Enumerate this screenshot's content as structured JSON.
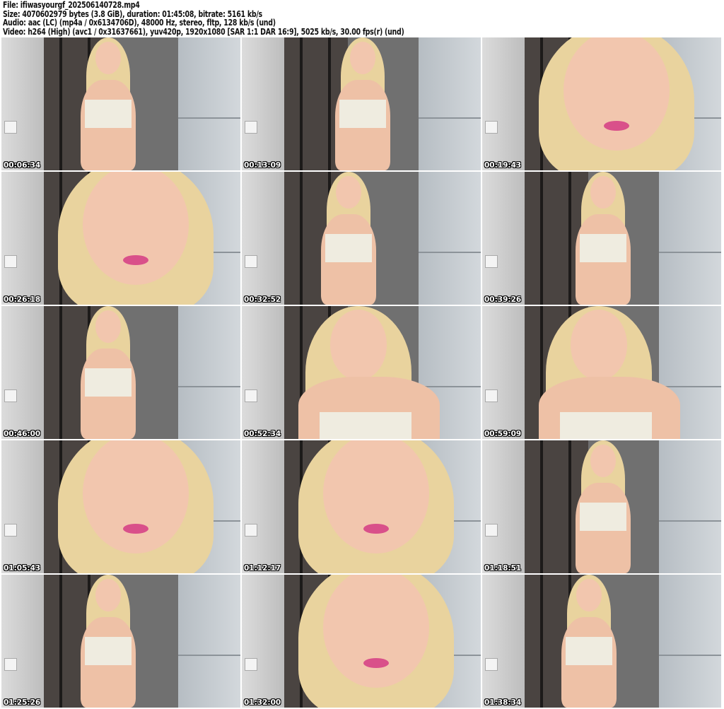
{
  "header": {
    "file_line": "File: ifiwasyourgf_202506140728.mp4",
    "size_line": "Size: 4070602979 bytes (3.8 GiB), duration: 01:45:08, bitrate: 5161 kb/s",
    "audio_line": "Audio: aac (LC) (mp4a / 0x6134706D), 48000 Hz, stereo, fltp, 128 kb/s (und)",
    "video_line": "Video: h264 (High) (avc1 / 0x31637661), yuv420p, 1920x1080 [SAR 1:1 DAR 16:9], 5025 kb/s, 30.00 fps(r) (und)"
  },
  "thumbnails": [
    {
      "timestamp": "00:06:34",
      "shot": "full"
    },
    {
      "timestamp": "00:13:09",
      "shot": "full"
    },
    {
      "timestamp": "00:19:43",
      "shot": "closeup"
    },
    {
      "timestamp": "00:26:18",
      "shot": "closeup"
    },
    {
      "timestamp": "00:32:52",
      "shot": "full"
    },
    {
      "timestamp": "00:39:26",
      "shot": "full"
    },
    {
      "timestamp": "00:46:00",
      "shot": "full"
    },
    {
      "timestamp": "00:52:34",
      "shot": "medium"
    },
    {
      "timestamp": "00:59:09",
      "shot": "medium"
    },
    {
      "timestamp": "01:05:43",
      "shot": "closeup"
    },
    {
      "timestamp": "01:12:17",
      "shot": "closeup"
    },
    {
      "timestamp": "01:18:51",
      "shot": "full"
    },
    {
      "timestamp": "01:25:26",
      "shot": "full"
    },
    {
      "timestamp": "01:32:00",
      "shot": "closeup"
    },
    {
      "timestamp": "01:38:34",
      "shot": "full"
    }
  ]
}
